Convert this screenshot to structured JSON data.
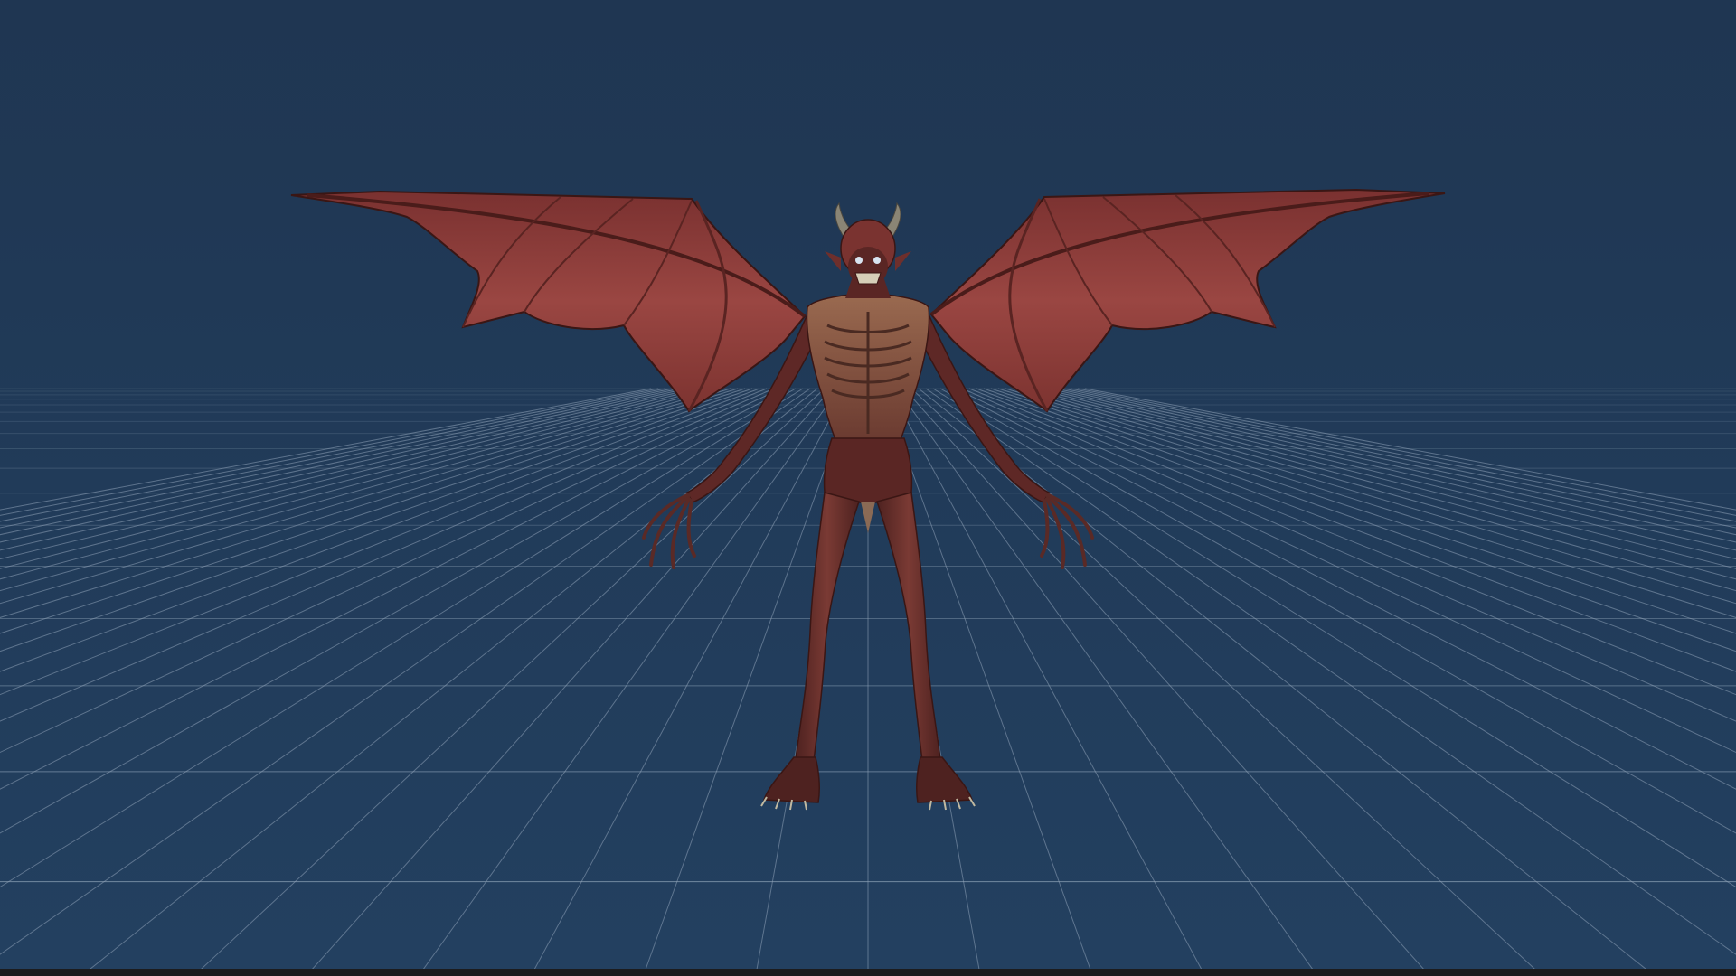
{
  "viewport": {
    "background_color": "#223a56",
    "grid_color": "#8fa3b8",
    "model": {
      "name": "",
      "skin_color": "#6e2f2c",
      "wing_color": "#8a3a37",
      "horn_color": "#8a8575",
      "rib_color": "#b08a6a"
    }
  },
  "bottom_bar": {
    "color": "#1c1c1e"
  }
}
